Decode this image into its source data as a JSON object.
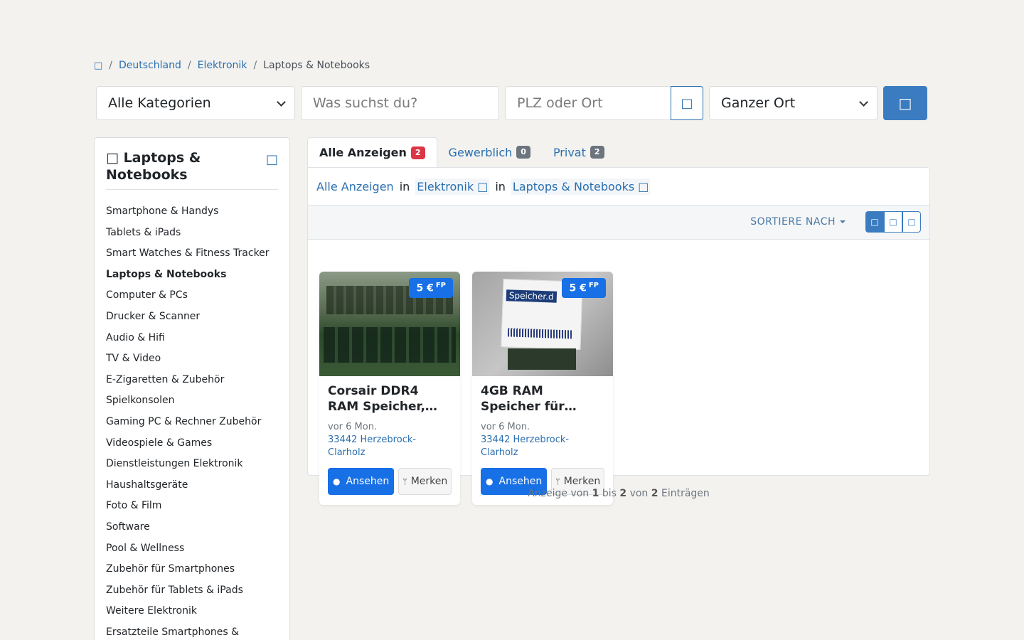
{
  "breadcrumb": {
    "home_icon": "□",
    "items": [
      "Deutschland",
      "Elektronik"
    ],
    "current": "Laptops & Notebooks"
  },
  "search": {
    "category_value": "Alle Kategorien",
    "query_placeholder": "Was suchst du?",
    "location_placeholder": "PLZ oder Ort",
    "location_icon": "□",
    "radius_value": "Ganzer Ort",
    "search_icon": "□"
  },
  "sidebar": {
    "title_icon": "□",
    "title": "Laptops & Notebooks",
    "filter_icon": "□",
    "categories": [
      "Smartphone & Handys",
      "Tablets & iPads",
      "Smart Watches & Fitness Tracker",
      "Laptops & Notebooks",
      "Computer & PCs",
      "Drucker & Scanner",
      "Audio & Hifi",
      "TV & Video",
      "E-Zigaretten & Zubehör",
      "Spielkonsolen",
      "Gaming PC & Rechner Zubehör",
      "Videospiele & Games",
      "Dienstleistungen Elektronik",
      "Haushaltsgeräte",
      "Foto & Film",
      "Software",
      "Pool & Wellness",
      "Zubehör für Smartphones",
      "Zubehör für Tablets & iPads",
      "Weitere Elektronik",
      "Ersatzteile Smartphones &"
    ]
  },
  "tabs": [
    {
      "label": "Alle Anzeigen",
      "count": "2"
    },
    {
      "label": "Gewerblich",
      "count": "0"
    },
    {
      "label": "Privat",
      "count": "2"
    }
  ],
  "filter": {
    "all": "Alle Anzeigen",
    "in": "in",
    "cat1": "Elektronik",
    "cat2": "Laptops & Notebooks",
    "remove_icon": "□"
  },
  "sort": {
    "label": "SORTIERE NACH",
    "view_icons": [
      "□",
      "□",
      "□"
    ]
  },
  "listings": [
    {
      "price": "5 €",
      "price_suffix": "FP",
      "title": "Corsair DDR4 RAM Speicher,…",
      "date": "vor 6 Mon.",
      "location": "33442 Herzebrock-Clarholz",
      "view_label": "Ansehen",
      "save_label": "Merken"
    },
    {
      "price": "5 €",
      "price_suffix": "FP",
      "title": "4GB RAM Speicher für…",
      "date": "vor 6 Mon.",
      "location": "33442 Herzebrock-Clarholz",
      "view_label": "Ansehen",
      "save_label": "Merken",
      "image_text": "Speicher.d"
    }
  ],
  "pagination": {
    "prefix": "Anzeige von",
    "from": "1",
    "mid1": "bis",
    "to": "2",
    "mid2": "von",
    "total": "2",
    "suffix": "Einträgen"
  }
}
